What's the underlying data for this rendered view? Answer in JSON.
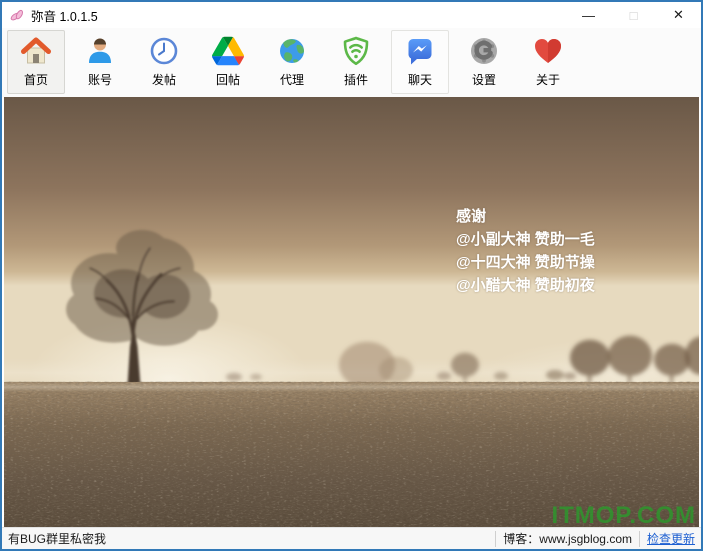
{
  "window": {
    "title": "弥音 1.0.1.5",
    "controls": {
      "minimize": "—",
      "maximize": "□",
      "close": "✕"
    }
  },
  "toolbar": {
    "buttons": [
      {
        "label": "首页",
        "icon": "home-icon",
        "state": "checked"
      },
      {
        "label": "账号",
        "icon": "user-icon",
        "state": "normal"
      },
      {
        "label": "发帖",
        "icon": "clock-icon",
        "state": "normal"
      },
      {
        "label": "回帖",
        "icon": "drive-triangle-icon",
        "state": "normal"
      },
      {
        "label": "代理",
        "icon": "globe-icon",
        "state": "normal"
      },
      {
        "label": "插件",
        "icon": "shield-signal-icon",
        "state": "normal"
      },
      {
        "label": "聊天",
        "icon": "messenger-icon",
        "state": "hover"
      },
      {
        "label": "设置",
        "icon": "authenticator-gear-icon",
        "state": "normal"
      },
      {
        "label": "关于",
        "icon": "heart-icon",
        "state": "normal"
      }
    ]
  },
  "wallpaper": {
    "credits_title": "感谢",
    "credits_lines": [
      "@小副大神 赞助一毛",
      "@十四大神 赞助节操",
      "@小醋大神 赞助初夜"
    ],
    "watermark": "ITMOP.COM",
    "watermark_color": "#2c992c",
    "description": "sepia foggy field with lone bare tree"
  },
  "statusbar": {
    "left_text": "有BUG群里私密我",
    "blog_text": "博客：www.jsgblog.com",
    "update_link": "检查更新",
    "link_color": "#1d5fd1"
  },
  "colors": {
    "window_border": "#3279b7",
    "toolbar_bg": "#fbfbfb",
    "sky_top": "#6a5847",
    "ground_bottom": "#564838"
  }
}
